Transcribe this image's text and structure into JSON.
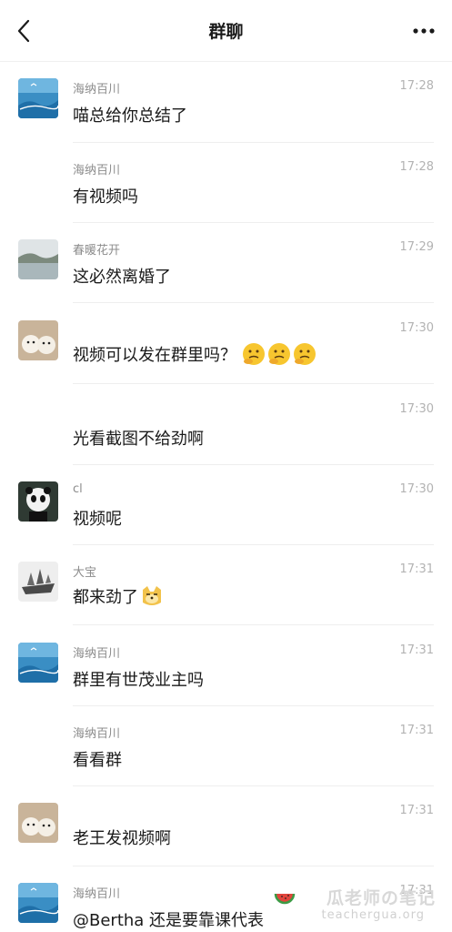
{
  "header": {
    "title": "群聊",
    "back_icon": "chevron-left-icon",
    "more_icon": "more-dots-icon"
  },
  "messages": [
    {
      "sender": "海纳百川",
      "time": "17:28",
      "text": "喵总给你总结了",
      "avatar": "sea-avatar"
    },
    {
      "sender": "海纳百川",
      "time": "17:28",
      "text": "有视频吗",
      "avatar": ""
    },
    {
      "sender": "春暖花开",
      "time": "17:29",
      "text": "这必然离婚了",
      "avatar": "lake-avatar"
    },
    {
      "sender": "",
      "time": "17:30",
      "text": "视频可以发在群里吗？",
      "avatar": "puppies-avatar",
      "emoji": "thinking-face-emoji"
    },
    {
      "sender": "",
      "time": "17:30",
      "text": "光看截图不给劲啊",
      "avatar": ""
    },
    {
      "sender": "cl",
      "time": "17:30",
      "text": "视频呢",
      "avatar": "panda-avatar"
    },
    {
      "sender": "大宝",
      "time": "17:31",
      "text": "都来劲了",
      "avatar": "ship-avatar",
      "emoji": "doge-emoji"
    },
    {
      "sender": "海纳百川",
      "time": "17:31",
      "text": "群里有世茂业主吗",
      "avatar": "sea-avatar"
    },
    {
      "sender": "海纳百川",
      "time": "17:31",
      "text": "看看群",
      "avatar": ""
    },
    {
      "sender": "",
      "time": "17:31",
      "text": "老王发视频啊",
      "avatar": "puppies-avatar"
    },
    {
      "sender": "海纳百川",
      "time": "17:31",
      "text": "@Bertha 还是要靠课代表",
      "avatar": "sea-avatar"
    }
  ],
  "watermark": {
    "title": "瓜老师の笔记",
    "url": "teachergua.org",
    "icon": "watermelon-icon"
  },
  "colors": {
    "background": "#ffffff",
    "sender_text": "#8c8c8c",
    "time_text": "#b3b3b3",
    "message_text": "#1a1a1a"
  }
}
